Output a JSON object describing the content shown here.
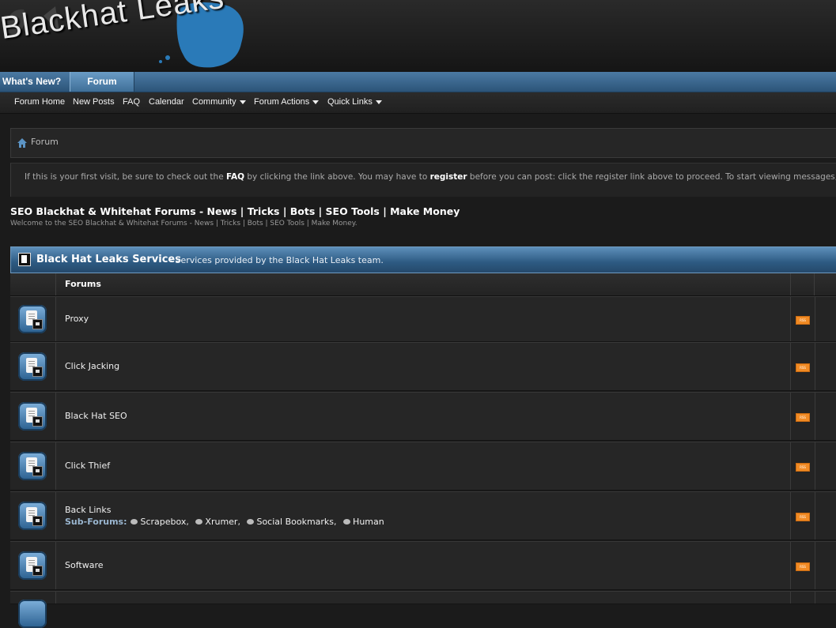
{
  "header": {
    "logo_text": "Blackhat Leaks"
  },
  "topnav": {
    "whats_new": "What's New?",
    "forum": "Forum"
  },
  "subnav": {
    "items": [
      "Forum Home",
      "New Posts",
      "FAQ",
      "Calendar",
      "Community",
      "Forum Actions",
      "Quick Links"
    ]
  },
  "breadcrumb": {
    "label": "Forum"
  },
  "notice": {
    "part1": "If this is your first visit, be sure to check out the ",
    "faq": "FAQ",
    "part2": " by clicking the link above. You may have to ",
    "register": "register",
    "part3": " before you can post: click the register link above to proceed. To start viewing messages, select the forum that you want to visit from the selection below."
  },
  "site": {
    "title": "SEO Blackhat & Whitehat Forums - News | Tricks | Bots | SEO Tools | Make Money",
    "description": "Welcome to the SEO Blackhat & Whitehat Forums - News | Tricks | Bots | SEO Tools | Make Money."
  },
  "category": {
    "name": "Black Hat Leaks Services",
    "description": "- Services provided by the Black Hat Leaks team."
  },
  "table": {
    "header": "Forums"
  },
  "forums": [
    {
      "name": "Proxy"
    },
    {
      "name": "Click Jacking"
    },
    {
      "name": "Black Hat SEO"
    },
    {
      "name": "Click Thief"
    },
    {
      "name": "Back Links",
      "subforums_label": "Sub-Forums:",
      "subforums": [
        "Scrapebox",
        "Xrumer",
        "Social Bookmarks",
        "Human"
      ]
    },
    {
      "name": "Software"
    }
  ],
  "colors": {
    "accent": "#3f6f98",
    "rss": "#f08a24"
  }
}
